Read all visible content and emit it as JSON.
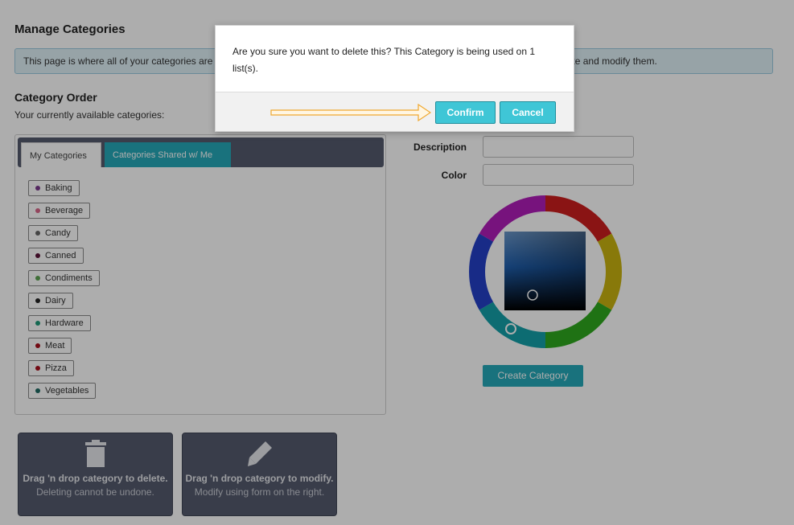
{
  "page": {
    "title": "Manage Categories",
    "info": "This page is where all of your categories are managed. Drag and drop categories to reorder them or use the boxes below to delete and modify them."
  },
  "order": {
    "title": "Category Order",
    "subtitle": "Your currently available categories:"
  },
  "tabs": {
    "my": "My Categories",
    "shared": "Categories Shared w/ Me"
  },
  "categories": [
    {
      "label": "Baking",
      "color": "#7b3a8c"
    },
    {
      "label": "Beverage",
      "color": "#d9668a"
    },
    {
      "label": "Candy",
      "color": "#666666"
    },
    {
      "label": "Canned",
      "color": "#5a1238"
    },
    {
      "label": "Condiments",
      "color": "#5ea352"
    },
    {
      "label": "Dairy",
      "color": "#222222"
    },
    {
      "label": "Hardware",
      "color": "#1e9a78"
    },
    {
      "label": "Meat",
      "color": "#a8101c"
    },
    {
      "label": "Pizza",
      "color": "#a8101c"
    },
    {
      "label": "Vegetables",
      "color": "#1f6b64"
    }
  ],
  "drop": {
    "delete_bold": "Drag 'n drop category to delete.",
    "delete_rest": " Deleting cannot be undone.",
    "modify_bold": "Drag 'n drop category to modify.",
    "modify_rest": " Modify using form on the right."
  },
  "form": {
    "description_label": "Description",
    "color_label": "Color",
    "description_value": "",
    "color_value": "",
    "create_button": "Create Category"
  },
  "modal": {
    "message": "Are you sure you want to delete this? This Category is being used on 1 list(s).",
    "confirm": "Confirm",
    "cancel": "Cancel"
  },
  "colors": {
    "accent": "#26a9b8",
    "modal_button": "#3fc6d6",
    "dark_panel": "#555b6e",
    "arrow": "#f0a830"
  },
  "icons": {
    "delete": "trash-icon",
    "modify": "pencil-icon",
    "pointer": "arrow-right-icon"
  }
}
